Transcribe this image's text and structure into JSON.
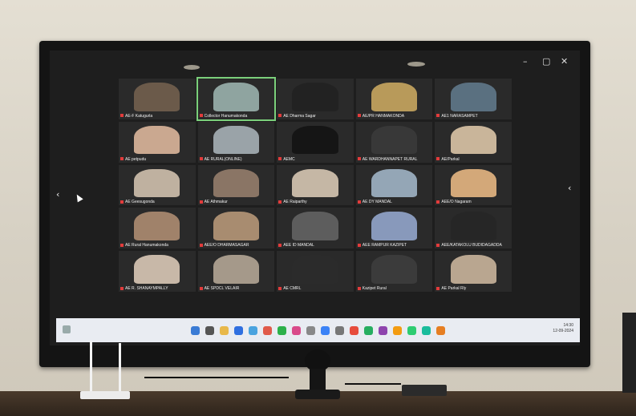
{
  "scene": {
    "description_colors": {
      "wall": "#ddd8cc",
      "monitor_bezel": "#141414",
      "screen_bg": "#1e1e1e",
      "taskbar": "#e9ecf2",
      "active_speaker_outline": "#7bd07b",
      "muted_mic": "#e23b3b"
    }
  },
  "window_controls": [
    "–",
    "▢",
    "✕"
  ],
  "nav": {
    "prev": "‹",
    "next": "‹"
  },
  "participants": [
    {
      "label": "AE-F Katugurla",
      "tone": "#6b5a4a"
    },
    {
      "label": "Collector Hanumakonda",
      "tone": "#8fa4a0",
      "active": true
    },
    {
      "label": "AE Dharma Sagar",
      "tone": "#222"
    },
    {
      "label": "AE/PR HANMAKONDA",
      "tone": "#b89a5a"
    },
    {
      "label": "AE1 NARASAMPET",
      "tone": "#5a7080"
    },
    {
      "label": "AE petpudu",
      "tone": "#caa890"
    },
    {
      "label": "AE RURAL(ONLINE)",
      "tone": "#9aa3a8"
    },
    {
      "label": "AEMC",
      "tone": "#151515"
    },
    {
      "label": "AE WARDHANNAPET RURAL",
      "tone": "#383838"
    },
    {
      "label": "AE/Parkal",
      "tone": "#c9b59a"
    },
    {
      "label": "AE Geesugonda",
      "tone": "#bfb1a0"
    },
    {
      "label": "AE Athmakur",
      "tone": "#8a7565"
    },
    {
      "label": "AE Raiparthy",
      "tone": "#c5b7a5"
    },
    {
      "label": "AE DY MANDAL",
      "tone": "#94a6b6"
    },
    {
      "label": "AEE/O Nagaram",
      "tone": "#d3a879"
    },
    {
      "label": "AE Rural Hanumakonda",
      "tone": "#a0826a"
    },
    {
      "label": "AEE/O DHARMASAGAR",
      "tone": "#a88c70"
    },
    {
      "label": "AEE ID MANDAL",
      "tone": "#5d5d5d"
    },
    {
      "label": "AEE RAMPUR KAZIPET",
      "tone": "#8899bb"
    },
    {
      "label": "AEE/KATAKOLU BUDIDAGADDA",
      "tone": "#262626"
    },
    {
      "label": "AE R. SHANAYMPALLY",
      "tone": "#c8b8a8"
    },
    {
      "label": "AE SPDCL VELAIR",
      "tone": "#a5998a"
    },
    {
      "label": "AE CMRL",
      "tone": "#2b2b2b"
    },
    {
      "label": "Kazipet Rural",
      "tone": "#3b3b3b"
    },
    {
      "label": "AE Parkal Rly",
      "tone": "#b9a690"
    }
  ],
  "taskbar": {
    "icons": [
      "#3a7bd5",
      "#555",
      "#e8b84a",
      "#2f6fe0",
      "#4aa3df",
      "#e05a4a",
      "#2db04a",
      "#d94a8a",
      "#888",
      "#3b82f6",
      "#777",
      "#e74c3c",
      "#27ae60",
      "#8e44ad",
      "#f39c12",
      "#2ecc71",
      "#1abc9c",
      "#e67e22"
    ],
    "tray_time": "14:30",
    "tray_date": "12-09-2024"
  }
}
